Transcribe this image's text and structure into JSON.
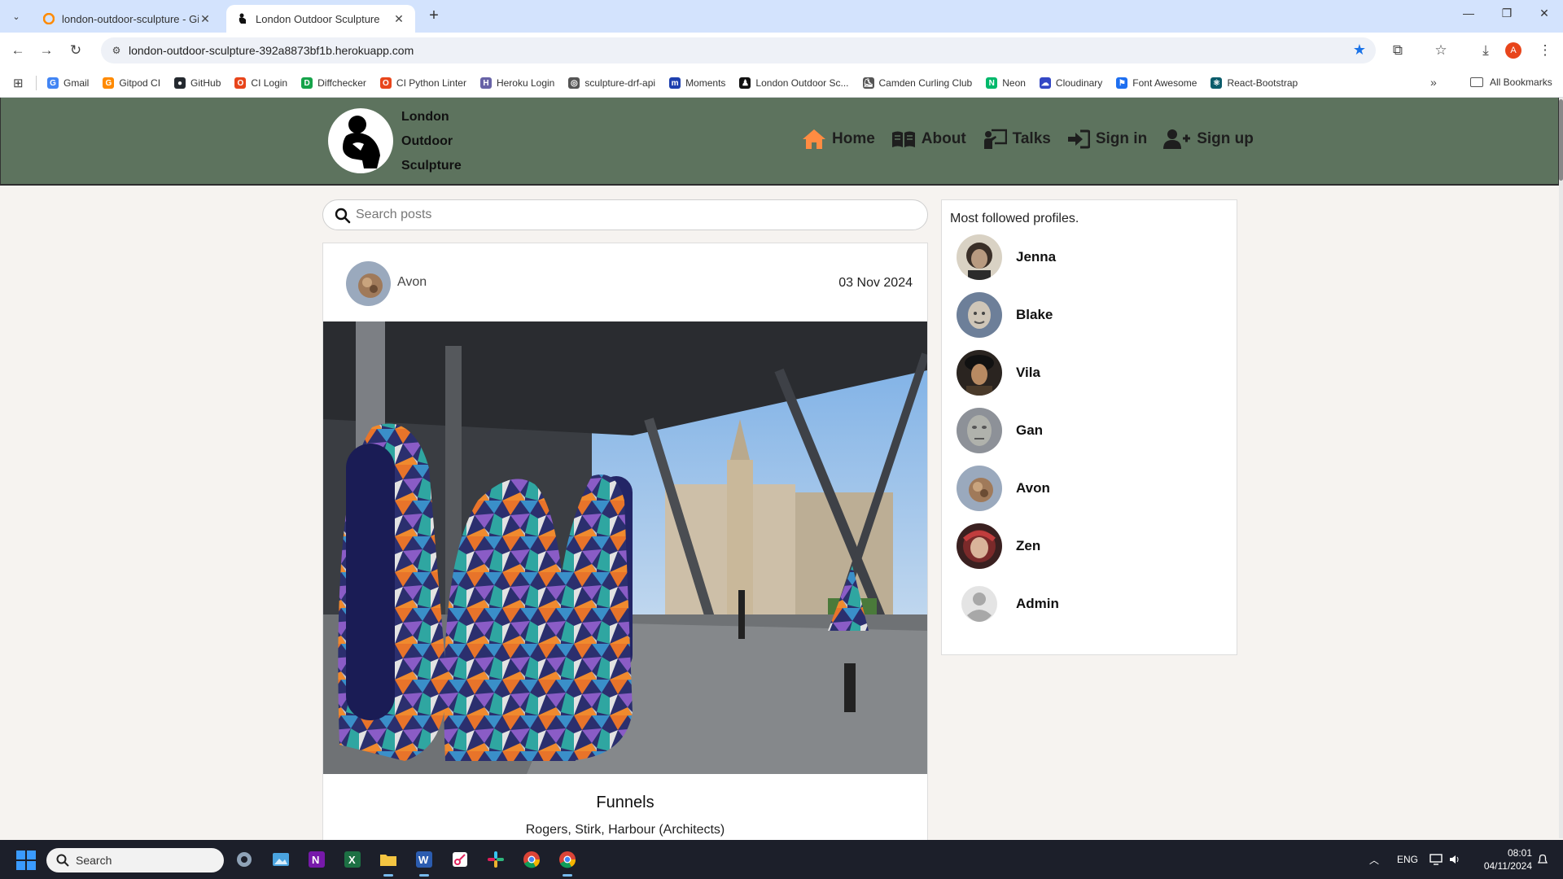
{
  "browser": {
    "tabs": [
      {
        "title": "london-outdoor-sculpture - Gi",
        "active": false
      },
      {
        "title": "London Outdoor Sculpture",
        "active": true
      }
    ],
    "url": "london-outdoor-sculpture-392a8873bf1b.herokuapp.com",
    "profile_initial": "A",
    "bookmarks": [
      {
        "label": "Gmail",
        "icon": "google-icon",
        "color": "#4285f4",
        "glyph": "G"
      },
      {
        "label": "Gitpod CI",
        "icon": "gitpod-icon",
        "color": "#ff8a00",
        "glyph": "G"
      },
      {
        "label": "GitHub",
        "icon": "github-icon",
        "color": "#24292f",
        "glyph": "●"
      },
      {
        "label": "CI Login",
        "icon": "ci-icon",
        "color": "#e8451b",
        "glyph": "O"
      },
      {
        "label": "Diffchecker",
        "icon": "diffchecker-icon",
        "color": "#16a34a",
        "glyph": "D"
      },
      {
        "label": "CI Python Linter",
        "icon": "ci-icon",
        "color": "#e8451b",
        "glyph": "O"
      },
      {
        "label": "Heroku Login",
        "icon": "heroku-icon",
        "color": "#6762a6",
        "glyph": "H"
      },
      {
        "label": "sculpture-drf-api",
        "icon": "globe-icon",
        "color": "#555555",
        "glyph": "◎"
      },
      {
        "label": "Moments",
        "icon": "moments-icon",
        "color": "#1e40af",
        "glyph": "m"
      },
      {
        "label": "London Outdoor Sc...",
        "icon": "thinker-icon",
        "color": "#111111",
        "glyph": "♟"
      },
      {
        "label": "Camden Curling Club",
        "icon": "curling-icon",
        "color": "#555555",
        "glyph": "⛸"
      },
      {
        "label": "Neon",
        "icon": "neon-icon",
        "color": "#00b86b",
        "glyph": "N"
      },
      {
        "label": "Cloudinary",
        "icon": "cloudinary-icon",
        "color": "#3448c5",
        "glyph": "☁"
      },
      {
        "label": "Font Awesome",
        "icon": "font-awesome-icon",
        "color": "#1e6ff0",
        "glyph": "⚑"
      },
      {
        "label": "React-Bootstrap",
        "icon": "react-bootstrap-icon",
        "color": "#0b5c6b",
        "glyph": "⚛"
      }
    ],
    "all_bookmarks": "All Bookmarks"
  },
  "site": {
    "brand": {
      "line1": "London",
      "line2": "Outdoor",
      "line3": "Sculpture"
    },
    "nav": {
      "home": "Home",
      "about": "About",
      "talks": "Talks",
      "sign_in": "Sign in",
      "sign_up": "Sign up"
    },
    "search": {
      "placeholder": "Search posts",
      "value": ""
    },
    "post": {
      "author": "Avon",
      "date": "03 Nov 2024",
      "title": "Funnels",
      "subtitle": "Rogers, Stirk, Harbour (Architects)"
    },
    "profiles": {
      "heading": "Most followed profiles.",
      "items": [
        {
          "name": "Jenna"
        },
        {
          "name": "Blake"
        },
        {
          "name": "Vila"
        },
        {
          "name": "Gan"
        },
        {
          "name": "Avon"
        },
        {
          "name": "Zen"
        },
        {
          "name": "Admin"
        }
      ]
    }
  },
  "taskbar": {
    "search_label": "Search",
    "language": "ENG",
    "time": "08:01",
    "date": "04/11/2024"
  },
  "colors": {
    "nav_bg": "#5d735e",
    "home_icon": "#ff8c42",
    "page_bg": "#f6f3f0"
  }
}
